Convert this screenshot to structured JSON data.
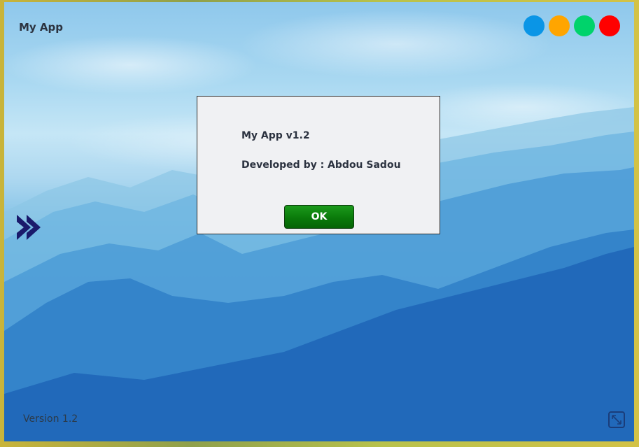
{
  "window": {
    "title": "My App",
    "version_text": "Version 1.2",
    "control_dots": [
      {
        "name": "blue-dot-button",
        "color": "#0a95e6"
      },
      {
        "name": "orange-dot-button",
        "color": "#ffa500"
      },
      {
        "name": "green-dot-button",
        "color": "#00d36b"
      },
      {
        "name": "red-dot-button",
        "color": "#ff0000"
      }
    ],
    "nav_icon": "double-chevron-right-icon",
    "resize_icon": "expand-icon"
  },
  "dialog": {
    "line1": "My App v1.2",
    "line2": "Developed by : Abdou Sadou",
    "ok_label": "OK"
  },
  "colors": {
    "title_text": "#2c3340",
    "ok_button": "#0a7a0a",
    "nav_icon": "#1a1a6b"
  }
}
